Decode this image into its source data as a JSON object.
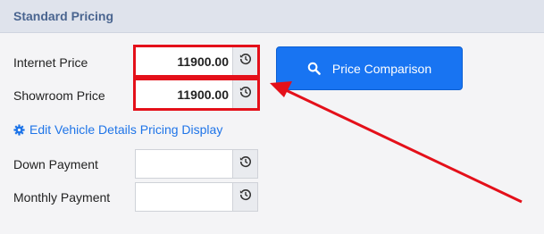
{
  "panel": {
    "title": "Standard Pricing"
  },
  "fields": {
    "internet_price": {
      "label": "Internet Price",
      "value": "11900.00"
    },
    "showroom_price": {
      "label": "Showroom Price",
      "value": "11900.00"
    },
    "down_payment": {
      "label": "Down Payment",
      "value": ""
    },
    "monthly_payment": {
      "label": "Monthly Payment",
      "value": ""
    }
  },
  "link": {
    "edit_label": "Edit Vehicle Details Pricing Display"
  },
  "button": {
    "compare_label": "Price Comparison"
  },
  "icons": {
    "reset": "history-icon",
    "search": "search-icon",
    "gear": "gear-icon"
  },
  "colors": {
    "header_bg": "#dfe3ec",
    "header_text": "#4a6590",
    "primary": "#1874f2",
    "link": "#1e74e8",
    "annotation": "#e4101a"
  }
}
